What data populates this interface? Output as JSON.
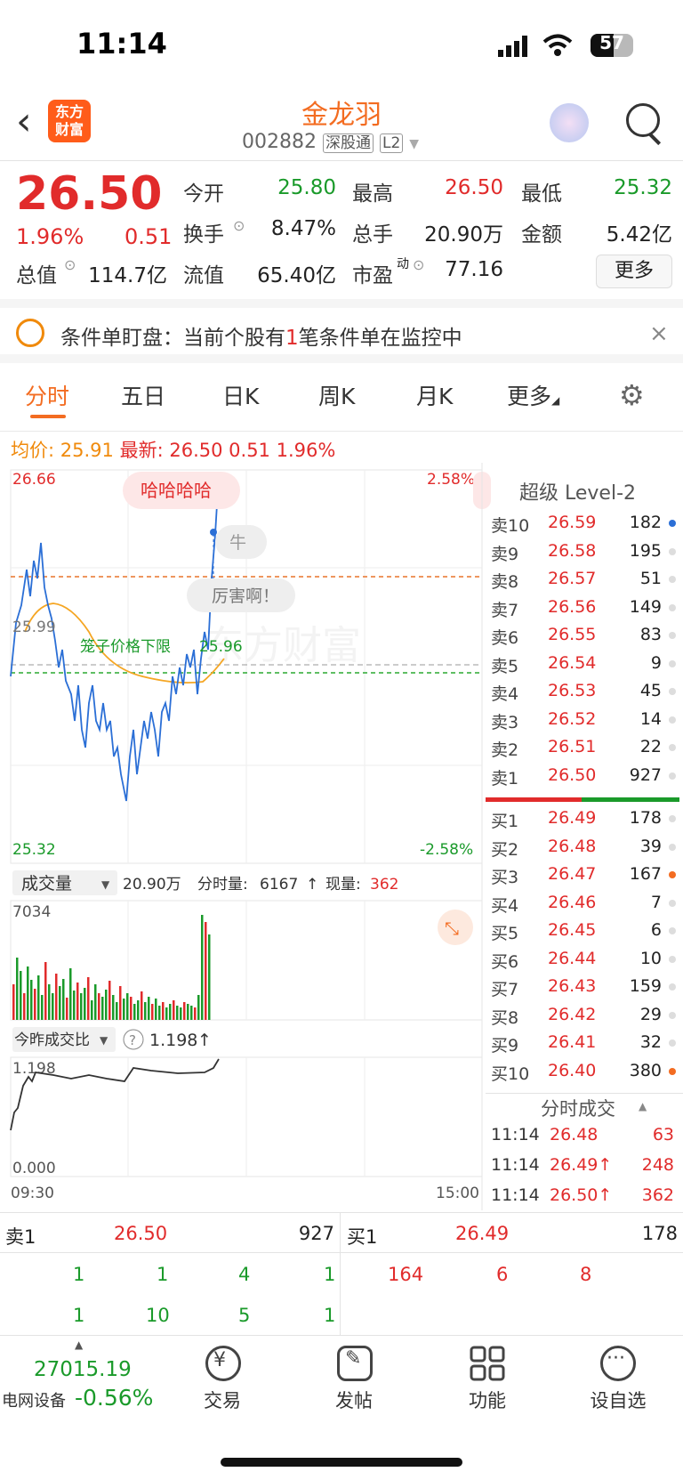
{
  "status_bar": {
    "time": "11:14",
    "battery": "57"
  },
  "header": {
    "logo": "东方财富",
    "stock_name": "金龙羽",
    "stock_code": "002882",
    "tag_market": "深股通",
    "tag_level": "L2"
  },
  "quote": {
    "price": "26.50",
    "pct": "1.96%",
    "change": "0.51",
    "open_label": "今开",
    "open": "25.80",
    "high_label": "最高",
    "high": "26.50",
    "low_label": "最低",
    "low": "25.32",
    "turnover_label": "换手",
    "turnover": "8.47%",
    "volume_label": "总手",
    "volume": "20.90万",
    "amount_label": "金额",
    "amount": "5.42亿",
    "mktcap_label": "总值",
    "mktcap": "114.7亿",
    "float_label": "流值",
    "float_cap": "65.40亿",
    "pe_label": "市盈",
    "pe_sup": "动",
    "pe": "77.16",
    "more_button": "更多"
  },
  "alert": {
    "prefix": "条件单盯盘：当前个股有",
    "count": "1",
    "suffix": "笔条件单在监控中"
  },
  "tabs": [
    "分时",
    "五日",
    "日K",
    "周K",
    "月K",
    "更多"
  ],
  "info_line": {
    "avg_label": "均价:",
    "avg": "25.91",
    "latest_label": "最新:",
    "latest": "26.50",
    "chg": "0.51",
    "pct": "1.96%"
  },
  "chart": {
    "price_top": "26.66",
    "pct_top": "2.58%",
    "price_bottom": "25.32",
    "pct_bottom": "-2.58%",
    "ref_price": "25.99",
    "cage_label": "笼子价格下限",
    "cage_value": "25.96",
    "bubbles": [
      "哈哈哈哈",
      "牛",
      "厉害啊！"
    ],
    "watermark": "东方财富",
    "volume_selector": "成交量",
    "volume_total": "20.90万",
    "volume_tick_label": "分时量:",
    "volume_tick": "6167",
    "volume_now_label": "现量:",
    "volume_now": "362",
    "volume_max": "7034",
    "ratio_selector": "今昨成交比",
    "ratio_value": "1.198",
    "ratio_top": "1.198",
    "ratio_bottom": "0.000",
    "time_start": "09:30",
    "time_end": "15:00"
  },
  "order_book": {
    "title": "超级 Level-2",
    "asks": [
      {
        "label": "卖10",
        "price": "26.59",
        "vol": "182"
      },
      {
        "label": "卖9",
        "price": "26.58",
        "vol": "195"
      },
      {
        "label": "卖8",
        "price": "26.57",
        "vol": "51"
      },
      {
        "label": "卖7",
        "price": "26.56",
        "vol": "149"
      },
      {
        "label": "卖6",
        "price": "26.55",
        "vol": "83"
      },
      {
        "label": "卖5",
        "price": "26.54",
        "vol": "9"
      },
      {
        "label": "卖4",
        "price": "26.53",
        "vol": "45"
      },
      {
        "label": "卖3",
        "price": "26.52",
        "vol": "14"
      },
      {
        "label": "卖2",
        "price": "26.51",
        "vol": "22"
      },
      {
        "label": "卖1",
        "price": "26.50",
        "vol": "927"
      }
    ],
    "bids": [
      {
        "label": "买1",
        "price": "26.49",
        "vol": "178"
      },
      {
        "label": "买2",
        "price": "26.48",
        "vol": "39"
      },
      {
        "label": "买3",
        "price": "26.47",
        "vol": "167"
      },
      {
        "label": "买4",
        "price": "26.46",
        "vol": "7"
      },
      {
        "label": "买5",
        "price": "26.45",
        "vol": "6"
      },
      {
        "label": "买6",
        "price": "26.44",
        "vol": "10"
      },
      {
        "label": "买7",
        "price": "26.43",
        "vol": "159"
      },
      {
        "label": "买8",
        "price": "26.42",
        "vol": "29"
      },
      {
        "label": "买9",
        "price": "26.41",
        "vol": "32"
      },
      {
        "label": "买10",
        "price": "26.40",
        "vol": "380"
      }
    ],
    "ticks_title": "分时成交",
    "ticks": [
      {
        "time": "11:14",
        "price": "26.48",
        "vol": "63"
      },
      {
        "time": "11:14",
        "price": "26.49↑",
        "vol": "248"
      },
      {
        "time": "11:14",
        "price": "26.50↑",
        "vol": "362"
      }
    ]
  },
  "bottom": {
    "sell_label": "卖1",
    "sell_price": "26.50",
    "sell_vol": "927",
    "buy_label": "买1",
    "buy_price": "26.49",
    "buy_vol": "178",
    "sell_row1": [
      "1",
      "1",
      "4",
      "1"
    ],
    "sell_row2": [
      "1",
      "10",
      "5",
      "1"
    ],
    "buy_row1": [
      "164",
      "6",
      "8"
    ]
  },
  "nav": {
    "index_value": "27015.19",
    "index_name": "电网设备",
    "index_pct": "-0.56%",
    "items": [
      "交易",
      "发帖",
      "功能",
      "设自选"
    ]
  }
}
